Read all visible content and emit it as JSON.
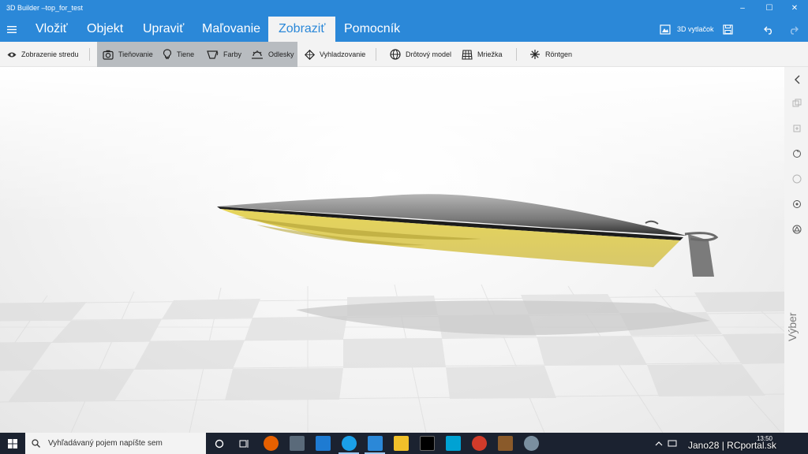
{
  "window": {
    "title": "3D Builder –top_for_test",
    "minimize_glyph": "–",
    "maximize_glyph": "☐",
    "close_glyph": "✕"
  },
  "menu": {
    "tabs": [
      {
        "label": "Vložiť"
      },
      {
        "label": "Objekt"
      },
      {
        "label": "Upraviť"
      },
      {
        "label": "Maľovanie"
      },
      {
        "label": "Zobraziť",
        "active": true
      },
      {
        "label": "Pomocník"
      }
    ],
    "print_label": "3D vytlačok"
  },
  "ribbon": {
    "center_view": "Zobrazenie stredu",
    "shading": "Tieňovanie",
    "shadows": "Tiene",
    "colors": "Farby",
    "reflections": "Odlesky",
    "smoothing": "Vyhladzovanie",
    "wireframe": "Drôtový model",
    "grid": "Mriežka",
    "xray": "Röntgen"
  },
  "sidebar": {
    "selection_label": "Výber"
  },
  "taskbar": {
    "search_placeholder": "Vyhľadávaný pojem napíšte sem",
    "time": "13:50",
    "overlay_text": "Jano28 | RCportal.sk"
  },
  "colors": {
    "accent": "#2b88d8",
    "hull_yellow": "#e8da5e",
    "deck_gray": "#8c8c8c",
    "taskbar": "#1b2230"
  }
}
